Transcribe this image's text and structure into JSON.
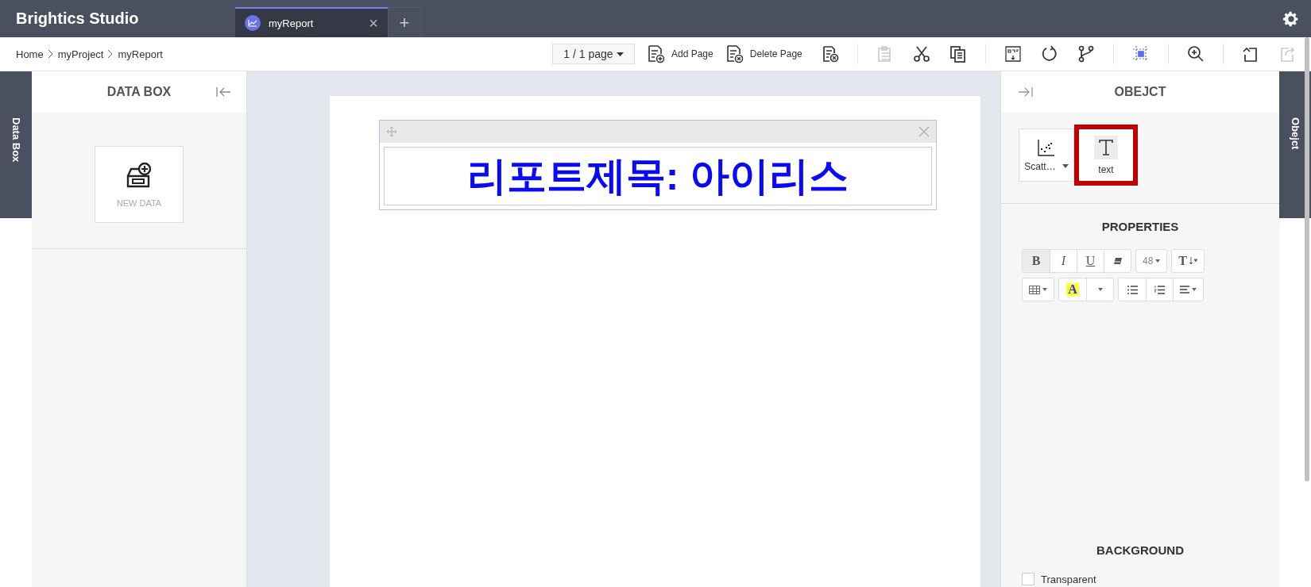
{
  "app": {
    "title": "Brightics Studio"
  },
  "tabs": [
    {
      "label": "myReport",
      "selected": true,
      "close": "×"
    }
  ],
  "new_tab": "+",
  "breadcrumb": [
    "Home",
    "myProject",
    "myReport"
  ],
  "page_selector": "1 / 1 page",
  "page_actions": [
    {
      "kind": "add",
      "label": "Add Page"
    },
    {
      "kind": "delete",
      "label": "Delete Page"
    }
  ],
  "toolbar_groups": [
    [
      {
        "kind": "report-close",
        "disabled": false,
        "active": false
      }
    ],
    [
      {
        "kind": "paste",
        "disabled": true,
        "active": false
      },
      {
        "kind": "cut",
        "disabled": false,
        "active": false
      },
      {
        "kind": "copy",
        "disabled": false,
        "active": false
      }
    ],
    [
      {
        "kind": "pdf",
        "disabled": false,
        "active": false
      },
      {
        "kind": "refresh",
        "disabled": false,
        "active": false
      },
      {
        "kind": "branch",
        "disabled": false,
        "active": false
      }
    ],
    [
      {
        "kind": "select-area",
        "disabled": false,
        "active": true
      }
    ],
    [
      {
        "kind": "zoom",
        "disabled": false,
        "active": false
      }
    ],
    [
      {
        "kind": "undo",
        "disabled": false,
        "active": false
      },
      {
        "kind": "redo",
        "disabled": true,
        "active": false
      }
    ]
  ],
  "left_tab": "Data Box",
  "data_box": {
    "title": "DATA BOX",
    "new_data": "NEW DATA"
  },
  "report": {
    "title_text": "리포트제목: 아이리스"
  },
  "object_panel": {
    "title": "OBEJCT",
    "objects": [
      {
        "kind": "scatter",
        "label": "Scatt…",
        "selected": false
      },
      {
        "kind": "text",
        "label": "text",
        "selected": true
      }
    ]
  },
  "properties": {
    "title": "PROPERTIES",
    "groups": [
      [
        {
          "kind": "bold",
          "label": "B",
          "selected": true
        },
        {
          "kind": "italic",
          "label": "I",
          "selected": false
        },
        {
          "kind": "underline",
          "label": "U",
          "selected": false
        },
        {
          "kind": "eraser",
          "selected": false
        }
      ],
      [
        {
          "kind": "font-size",
          "label": "48",
          "selected": false
        }
      ],
      [
        {
          "kind": "line-height",
          "label": "T",
          "selected": false
        }
      ],
      [
        {
          "kind": "table",
          "selected": false
        }
      ],
      [
        {
          "kind": "color",
          "label": "A",
          "selected": false
        },
        {
          "kind": "caret",
          "selected": false
        }
      ],
      [
        {
          "kind": "bullets",
          "selected": false
        },
        {
          "kind": "numbers",
          "selected": false
        },
        {
          "kind": "align",
          "selected": false
        }
      ]
    ]
  },
  "background": {
    "title": "BACKGROUND",
    "transparent": {
      "label": "Transparent",
      "checked": false
    }
  },
  "right_tab": "Obejct"
}
